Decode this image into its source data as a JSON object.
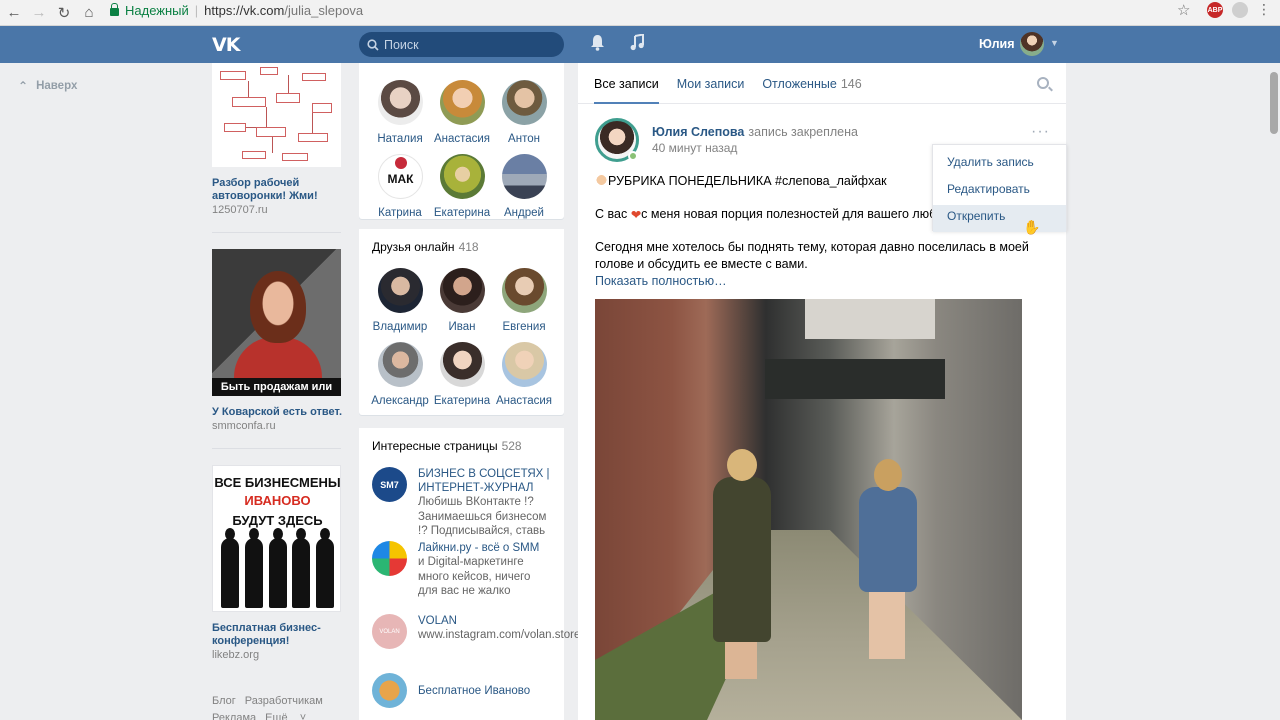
{
  "browser": {
    "secure_label": "Надежный",
    "url_host": "https://vk.com",
    "url_path": "/julia_slepova",
    "ext_badge": "ABP"
  },
  "header": {
    "search_placeholder": "Поиск",
    "user_name": "Юлия"
  },
  "left_nav": {
    "back_to_top": "Наверх"
  },
  "ads": [
    {
      "title": "Разбор рабочей автоворонки! Жми!",
      "domain": "1250707.ru"
    },
    {
      "title": "У Коварской есть ответ.",
      "domain": "smmconfa.ru",
      "image_caption": "Быть продажам или нет?"
    },
    {
      "title": "Бесплатная бизнес-конференция!",
      "domain": "likebz.org",
      "image_lines": [
        "ВСЕ БИЗНЕСМЕНЫ",
        "ИВАНОВО",
        "БУДУТ ЗДЕСЬ"
      ]
    }
  ],
  "footer_links": [
    "Блог",
    "Разработчикам",
    "Реклама",
    "Ещё"
  ],
  "friends": {
    "names_row1": [
      "Наталия",
      "Анастасия",
      "Антон"
    ],
    "names_row2": [
      "Катрина",
      "Екатерина",
      "Андрей"
    ],
    "mak_label": "МАК"
  },
  "friends_online": {
    "title": "Друзья онлайн",
    "count": "418",
    "names": [
      "Владимир",
      "Иван",
      "Евгения",
      "Александр",
      "Екатерина",
      "Анастасия"
    ]
  },
  "pages": {
    "title": "Интересные страницы",
    "count": "528",
    "items": [
      {
        "name": "БИЗНЕС В СОЦСЕТЯХ | ИНТЕРНЕТ-ЖУРНАЛ",
        "desc": "Любишь ВКонтакте !? Занимаешься бизнесом !? Подписывайся, ставь",
        "logo": "SM7"
      },
      {
        "name": "Лайкни.ру - всё о SMM",
        "desc": "и Digital-маркетинге много кейсов, ничего для вас не жалко"
      },
      {
        "name": "VOLAN",
        "desc": "www.instagram.com/volan.store",
        "logo": "VOLAN"
      },
      {
        "name": "Бесплатное Иваново",
        "desc": ""
      }
    ]
  },
  "wall": {
    "tabs": [
      {
        "label": "Все записи",
        "count": ""
      },
      {
        "label": "Мои записи",
        "count": ""
      },
      {
        "label": "Отложенные",
        "count": "146"
      }
    ],
    "post": {
      "author": "Юлия Слепова",
      "action": "запись закреплена",
      "time": "40 минут назад",
      "line1": "РУБРИКА ПОНЕДЕЛЬНИКА #слепова_лайфхак",
      "line2_a": "С вас ",
      "line2_b": "с меня новая порция полезностей для вашего люб",
      "line3": "Сегодня мне хотелось бы поднять тему, которая давно поселилась в моей голове и обсудить ее вместе с вами.",
      "show_more": "Показать полностью…"
    },
    "menu": [
      "Удалить запись",
      "Редактировать",
      "Открепить"
    ]
  }
}
